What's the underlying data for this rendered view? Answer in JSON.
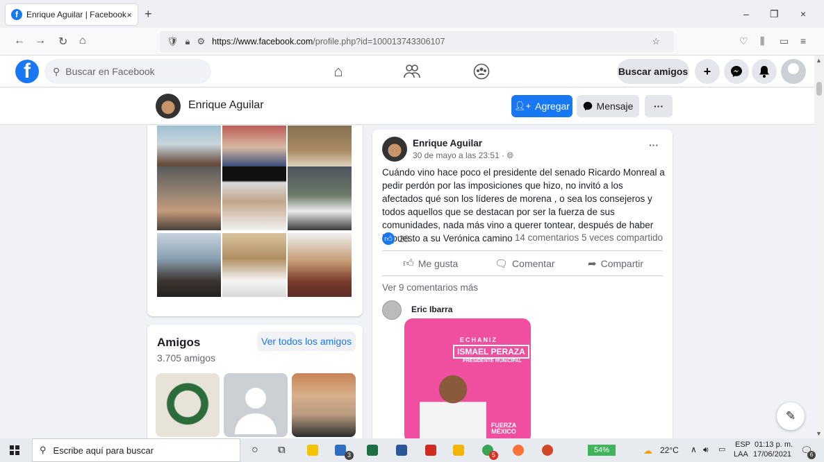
{
  "browser": {
    "tab_title": "Enrique Aguilar | Facebook",
    "tab_close": "×",
    "new_tab": "+",
    "url_domain": "https://www.facebook.com",
    "url_path": "/profile.php?id=100013743306107",
    "win_min": "–",
    "win_max": "❐",
    "win_close": "×"
  },
  "fb_header": {
    "logo": "f",
    "search_placeholder": "Buscar en Facebook",
    "find_friends": "Buscar amigos",
    "create": "+"
  },
  "profile_bar": {
    "name": "Enrique Aguilar",
    "add_label": "Agregar",
    "message_label": "Mensaje",
    "more": "···"
  },
  "friends": {
    "title": "Amigos",
    "count": "3.705 amigos",
    "see_all": "Ver todos los amigos"
  },
  "post": {
    "author": "Enrique Aguilar",
    "time": "30 de mayo a las 23:51 ·",
    "menu": "···",
    "text": "Cuándo vino hace poco el presidente del senado Ricardo Monreal a pedir perdón por las imposiciones que hizo, no invitó a los afectados qué son los líderes de morena , o sea los consejeros y todos aquellos que se destacan por ser la fuerza de sus comunidades, nada más vino a querer tontear, después de haber impuesto a su Verónica camino",
    "likes": "28",
    "stats": "14 comentarios 5 veces compartido",
    "like_label": "Me gusta",
    "comment_label": "Comentar",
    "share_label": "Compartir",
    "more_comments": "Ver 9 comentarios más",
    "commenter": "Eric Ibarra",
    "poster_line1": "ECHANIZ",
    "poster_line2": "ISMAEL PERAZA",
    "poster_line3": "PRESIDENTE MUNICIPAL",
    "poster_footer": "FUERZA MÉXICO"
  },
  "taskbar": {
    "search_placeholder": "Escribe aquí para buscar",
    "battery": "54%",
    "weather": "22°C",
    "lang1": "ESP",
    "lang2": "LAA",
    "time": "01:13 p. m.",
    "date": "17/06/2021",
    "badge_mail": "3",
    "badge_opera": "5",
    "badge_notif": "6"
  },
  "colors": {
    "fb_blue": "#1877f2",
    "bg": "#f0f2f5",
    "poster_pink": "#f04fa0"
  }
}
